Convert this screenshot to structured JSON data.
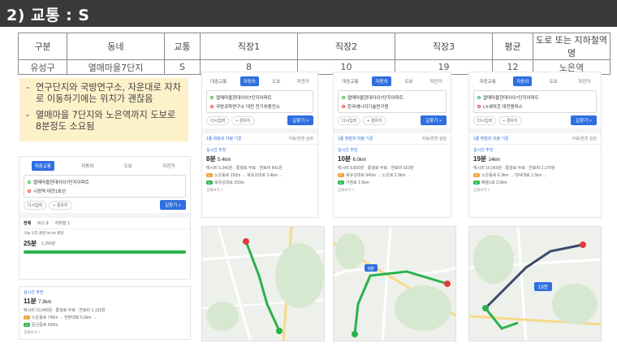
{
  "header": {
    "title": "2) 교통 : S"
  },
  "table": {
    "headers": [
      "구분",
      "동네",
      "교통",
      "직장1",
      "직장2",
      "직장3",
      "평균",
      "도로 또는 지하철역 명"
    ],
    "row": [
      "유성구",
      "열매마을7단지",
      "S",
      "8",
      "10",
      "19",
      "12",
      "노은역"
    ]
  },
  "notes": [
    "연구단지와 국방연구소, 자운대로 자차로 이동하기에는 위치가 괜찮음",
    "열매마을 7단지와 노은역까지 도보로 8분정도 소요됨"
  ],
  "colors": {
    "accent": "#2f6fe0",
    "title_bg": "#3a3a3a",
    "note_bg": "#fdf1c9",
    "highlight": "#e02020"
  },
  "modes": {
    "public": "대중교통",
    "car": "자동차",
    "walk": "도보",
    "bike": "자전거"
  },
  "common": {
    "origin": "열매마을현대아이7단지아파트",
    "add_stop": "다시입력",
    "waypoint": "+ 경유지",
    "search": "길찾기 >",
    "detail": "상세보기 >",
    "sort_right": "자동/변경 설정"
  },
  "card_left": {
    "dest": "시청역 대전1호선",
    "tabs": [
      "전체",
      "버스 8",
      "지하철 1"
    ],
    "time_row": "오늘 오후 출발 08:30 출발",
    "bus_time": "25분",
    "bus_fare_short": "1,250원",
    "route_rec": "실시간 추천",
    "route_time": "11분",
    "route_dist": "7.3km",
    "route_fare": "택시비 10,340원 · 통행료 무료 · 연료비 1,132원",
    "route_path1": "노은동로 745m → 한밭대로 5.9km →",
    "route_path2": "둔산중로 656m"
  },
  "card1": {
    "dest": "국방과학연구소 대전 전기차충전소",
    "sort": "1종 화랑유 차량 기준",
    "rec": "실시간 추천",
    "time": "8분",
    "dist": "5.4km",
    "fare": "택시비 6,340원 · 통행료 무료 · 연료비 841원",
    "path1": "노은동로 292m → 북유성대로 3.4km →",
    "path2": "북유성대로 293m"
  },
  "card2": {
    "dest": "한국에너지기술연구원",
    "sort": "1종 휘발유 차량 기준",
    "rec": "실시간 추천",
    "time": "10분",
    "dist": "6.0km",
    "fare": "택시비 8,800원 · 통행료 무료 · 연료비 923원",
    "path1": "북유성대로 946m → 노은로 2.9km →",
    "path2": "가정로 1.5km"
  },
  "card3": {
    "dest": "LX세미콘 대전캠퍼스",
    "sort": "1종 휘발유 차량 기준",
    "rec": "실시간 추천",
    "time": "19분",
    "dist": "14km",
    "fare": "택시비 16,060원 · 통행료 무료 · 연료비 2,170원",
    "path1": "노은동로 6.3km → 대덕대로 1.5km →",
    "path2": "배울1로 2.0km"
  },
  "map_labels": {
    "map3_badge": "19분",
    "map2_badge": "8분"
  }
}
